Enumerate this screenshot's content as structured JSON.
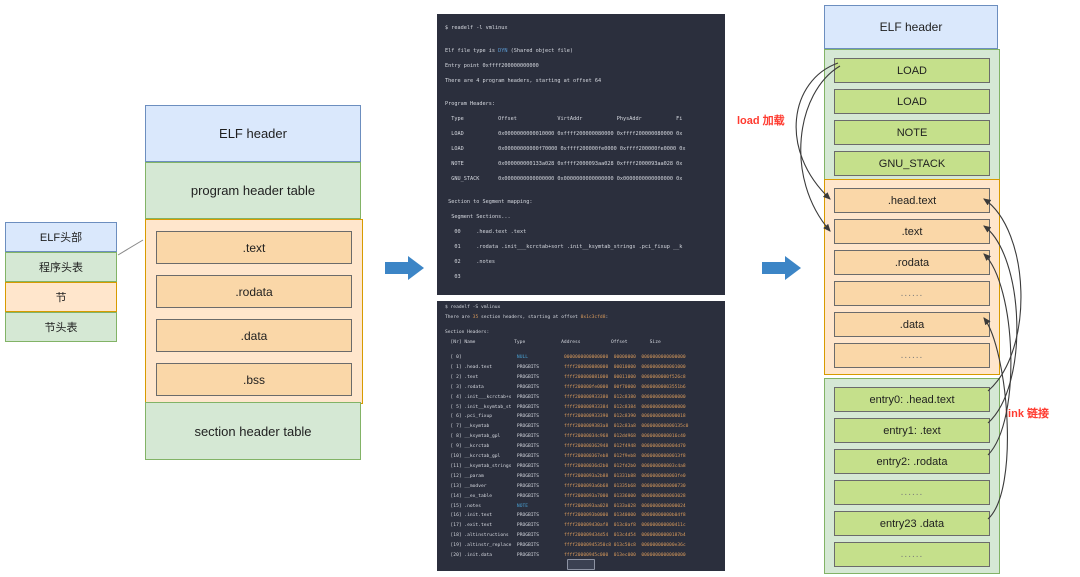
{
  "mini_stack": {
    "items": [
      {
        "label": "ELF头部",
        "style": "blue"
      },
      {
        "label": "程序头表",
        "style": "green"
      },
      {
        "label": "节",
        "style": "orange"
      },
      {
        "label": "节头表",
        "style": "green"
      }
    ]
  },
  "left_stack": {
    "elf_header": "ELF header",
    "program_header_table": "program header table",
    "sections": [
      ".text",
      ".rodata",
      ".data",
      ".bss"
    ],
    "section_header_table": "section header table"
  },
  "terminal_top": {
    "lines": [
      "$ readelf -l vmlinux",
      "",
      "Elf file type is DYN (Shared object file)",
      "Entry point 0xffff200000000000",
      "There are 4 program headers, starting at offset 64",
      "",
      "Program Headers:",
      "  Type           Offset             VirtAddr           PhysAddr           Fi",
      "  LOAD           0x0000000000010000 0xffff200000080000 0xffff200000080000 0x",
      "  LOAD           0x00000000000f70000 0xffff200000fe0000 0xffff200000fe0000 0x",
      "  NOTE           0x000000000133a028 0xffff2000093aa028 0xffff2000093aa028 0x",
      "  GNU_STACK      0x0000000000000000 0x0000000000000000 0x0000000000000000 0x",
      "",
      " Section to Segment mapping:",
      "  Segment Sections...",
      "   00     .head.text .text",
      "   01     .rodata .init___kcrctab+sort .init__ksymtab_strings .pci_fixup __k",
      "   02     .notes",
      "   03"
    ],
    "type_keyword": "DYN"
  },
  "terminal_bottom": {
    "header_lines": [
      "$ readelf -S vmlinux",
      "There are 35 section headers, starting at offset 0x1c3cfd8:",
      "",
      "Section Headers:",
      "  [Nr] Name              Type             Address           Offset        Size"
    ],
    "columns": [
      "[Nr] Name",
      "Type",
      "Address",
      "Offset",
      "Size"
    ],
    "rows": [
      {
        "nr": "[ 0]",
        "name": "",
        "type": "NULL",
        "addr": "0000000000000000",
        "off": "00000000",
        "size": "0000000000000000"
      },
      {
        "nr": "[ 1]",
        "name": ".head.text",
        "type": "PROGBITS",
        "addr": "ffff200000080000",
        "off": "00010000",
        "size": "0000000000001000"
      },
      {
        "nr": "[ 2]",
        "name": ".text",
        "type": "PROGBITS",
        "addr": "ffff200000081000",
        "off": "00011000",
        "size": "0000000000f526c8"
      },
      {
        "nr": "[ 3]",
        "name": ".rodata",
        "type": "PROGBITS",
        "addr": "ffff200000fe0000",
        "off": "00f70000",
        "size": "00000000003551b6"
      },
      {
        "nr": "[ 4]",
        "name": ".init___kcrctab+s",
        "type": "PROGBITS",
        "addr": "ffff200000933380",
        "off": "012c8380",
        "size": "0000000000000000"
      },
      {
        "nr": "[ 5]",
        "name": ".init__ksymtab_st",
        "type": "PROGBITS",
        "addr": "ffff200000933384",
        "off": "012c8384",
        "size": "0000000000000000"
      },
      {
        "nr": "[ 6]",
        "name": ".pci_fixup",
        "type": "PROGBITS",
        "addr": "ffff200000933390",
        "off": "012c8390",
        "size": "0000000000000018"
      },
      {
        "nr": "[ 7]",
        "name": "__ksymtab",
        "type": "PROGBITS",
        "addr": "ffff2000009383a8",
        "off": "012c83a8",
        "size": "000000000000135c0"
      },
      {
        "nr": "[ 8]",
        "name": "__ksymtab_gpl",
        "type": "PROGBITS",
        "addr": "ffff20000034c968",
        "off": "012dd968",
        "size": "0000000000016c40"
      },
      {
        "nr": "[ 9]",
        "name": "__kcrctab",
        "type": "PROGBITS",
        "addr": "ffff200000362948",
        "off": "012f4948",
        "size": "0000000000004d70"
      },
      {
        "nr": "[10]",
        "name": "__kcrctab_gpl",
        "type": "PROGBITS",
        "addr": "ffff200000367eb8",
        "off": "012f9eb8",
        "size": "00000000000013f8"
      },
      {
        "nr": "[11]",
        "name": "__ksymtab_strings",
        "type": "PROGBITS",
        "addr": "ffff20000036d2b0",
        "off": "012fd2b0",
        "size": "000000000003c4a8"
      },
      {
        "nr": "[12]",
        "name": "__param",
        "type": "PROGBITS",
        "addr": "ffff2000093a2b88",
        "off": "01331b88",
        "size": "0000000000003fe0"
      },
      {
        "nr": "[13]",
        "name": "__modver",
        "type": "PROGBITS",
        "addr": "ffff2000093a6b68",
        "off": "01335b68",
        "size": "0000000000000730"
      },
      {
        "nr": "[14]",
        "name": "__ex_table",
        "type": "PROGBITS",
        "addr": "ffff2000093a7000",
        "off": "01336000",
        "size": "0000000000003028"
      },
      {
        "nr": "[15]",
        "name": ".notes",
        "type": "NOTE",
        "addr": "ffff2000093aa028",
        "off": "0133a028",
        "size": "0000000000000024"
      },
      {
        "nr": "[16]",
        "name": ".init.text",
        "type": "PROGBITS",
        "addr": "ffff2000093b0000",
        "off": "01340000",
        "size": "00000000000b04f8"
      },
      {
        "nr": "[17]",
        "name": ".exit.text",
        "type": "PROGBITS",
        "addr": "ffff200009430af8",
        "off": "013c0af8",
        "size": "000000000000411c"
      },
      {
        "nr": "[18]",
        "name": ".altinstructions",
        "type": "PROGBITS",
        "addr": "ffff200009434d54",
        "off": "013c4d54",
        "size": "00000000000187b4"
      },
      {
        "nr": "[19]",
        "name": ".altinstr_replace",
        "type": "PROGBITS",
        "addr": "ffff20000945350c8",
        "off": "013c50c8",
        "size": "000000000000e36c"
      },
      {
        "nr": "[20]",
        "name": ".init.data",
        "type": "PROGBITS",
        "addr": "ffff20000945c000",
        "off": "013ec000",
        "size": "0000000000000000"
      }
    ]
  },
  "right_stack": {
    "elf_header": "ELF header",
    "segments": [
      "LOAD",
      "LOAD",
      "NOTE",
      "GNU_STACK"
    ],
    "sections": [
      ".head.text",
      ".text",
      ".rodata",
      "......",
      ".data",
      "......"
    ],
    "section_headers": [
      "entry0: .head.text",
      "entry1: .text",
      "entry2: .rodata",
      "......",
      "entry23 .data",
      "......"
    ]
  },
  "annotations": {
    "load": "load 加载",
    "link": "link 链接"
  },
  "colors": {
    "blue_fill": "#dae8fc",
    "blue_stroke": "#6c8ebf",
    "green_fill": "#d5e8d4",
    "green_stroke": "#82b366",
    "orange_fill": "#ffe6cc",
    "orange_stroke": "#d79b00",
    "inner_orange": "#fad7a8",
    "inner_green": "#c5e08b",
    "arrow_blue": "#3c85c6",
    "annotation_red": "#ff3b30",
    "terminal_bg": "#2b2f3d"
  }
}
